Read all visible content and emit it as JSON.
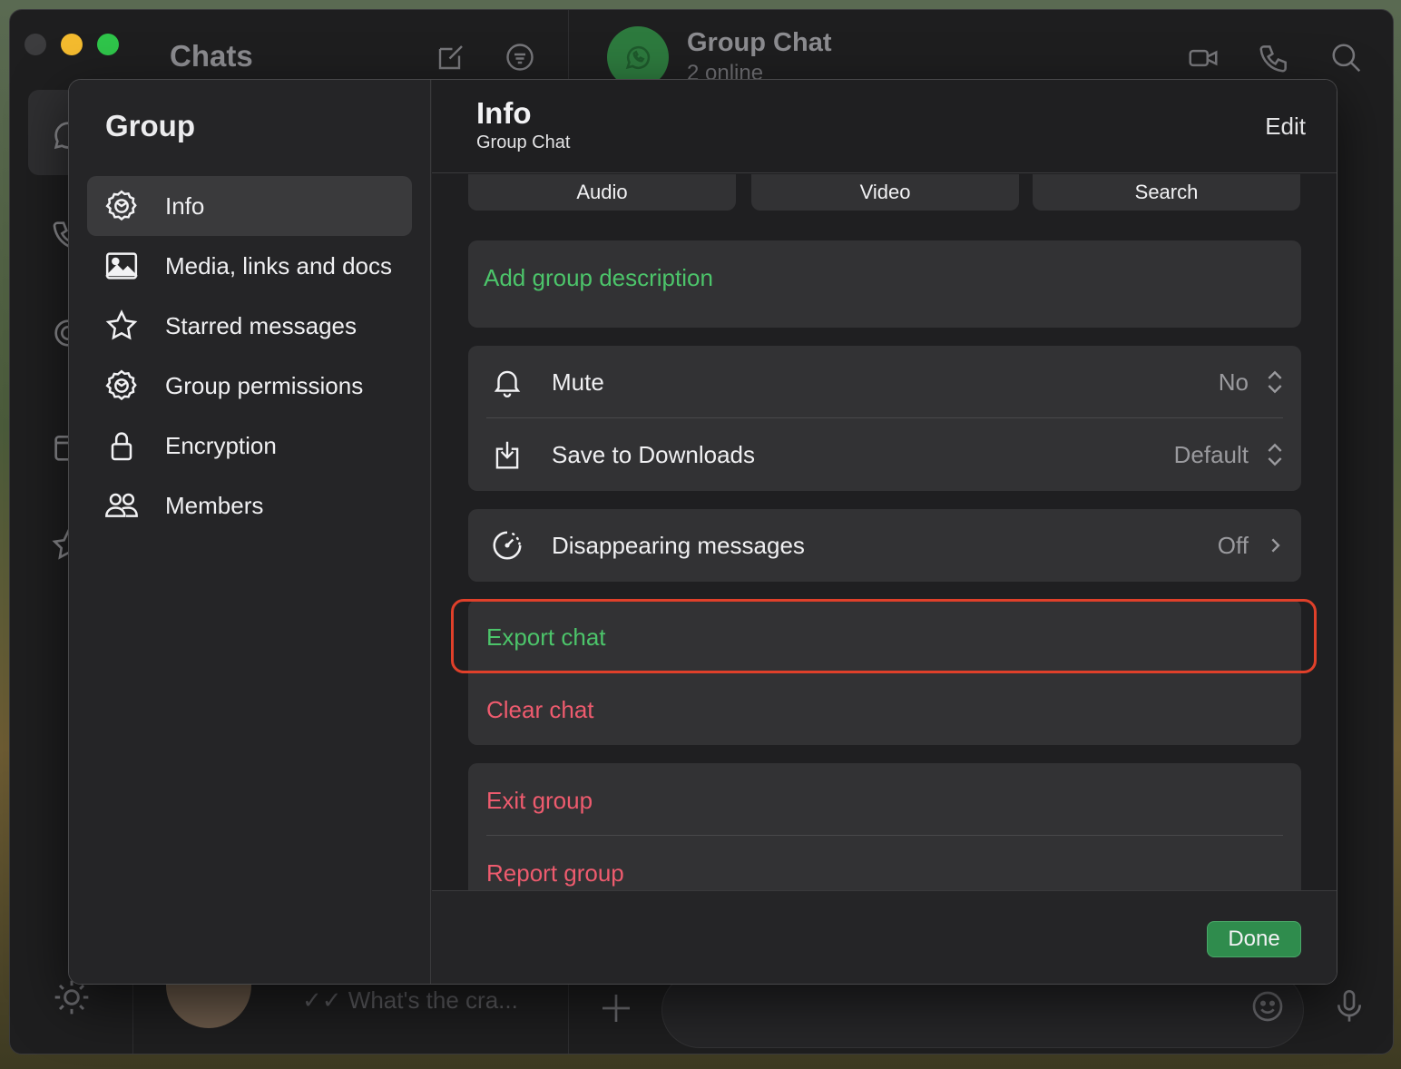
{
  "background_app": {
    "chats_title": "Chats",
    "conversation_title": "Group Chat",
    "conversation_subtitle": "2 online",
    "last_message_preview": "✓✓ What's the cra..."
  },
  "sheet": {
    "sidebar": {
      "title": "Group",
      "items": [
        {
          "label": "Info",
          "icon": "gear-icon",
          "active": true
        },
        {
          "label": "Media, links and docs",
          "icon": "image-icon",
          "active": false
        },
        {
          "label": "Starred messages",
          "icon": "star-icon",
          "active": false
        },
        {
          "label": "Group permissions",
          "icon": "gear-icon",
          "active": false
        },
        {
          "label": "Encryption",
          "icon": "lock-icon",
          "active": false
        },
        {
          "label": "Members",
          "icon": "people-icon",
          "active": false
        }
      ]
    },
    "header": {
      "title": "Info",
      "subtitle": "Group Chat",
      "edit_label": "Edit"
    },
    "quick_actions": [
      "Audio",
      "Video",
      "Search"
    ],
    "description_placeholder": "Add group description",
    "settings": {
      "mute": {
        "label": "Mute",
        "value": "No"
      },
      "save_to_downloads": {
        "label": "Save to Downloads",
        "value": "Default"
      },
      "disappearing": {
        "label": "Disappearing messages",
        "value": "Off"
      }
    },
    "actions": {
      "export_chat": "Export chat",
      "clear_chat": "Clear chat",
      "exit_group": "Exit group",
      "report_group": "Report group"
    },
    "done_label": "Done"
  },
  "colors": {
    "accent_green": "#4cc46a",
    "danger_red": "#ee5b6e",
    "highlight_outline": "#e0402a",
    "done_button": "#2f8c4d"
  }
}
